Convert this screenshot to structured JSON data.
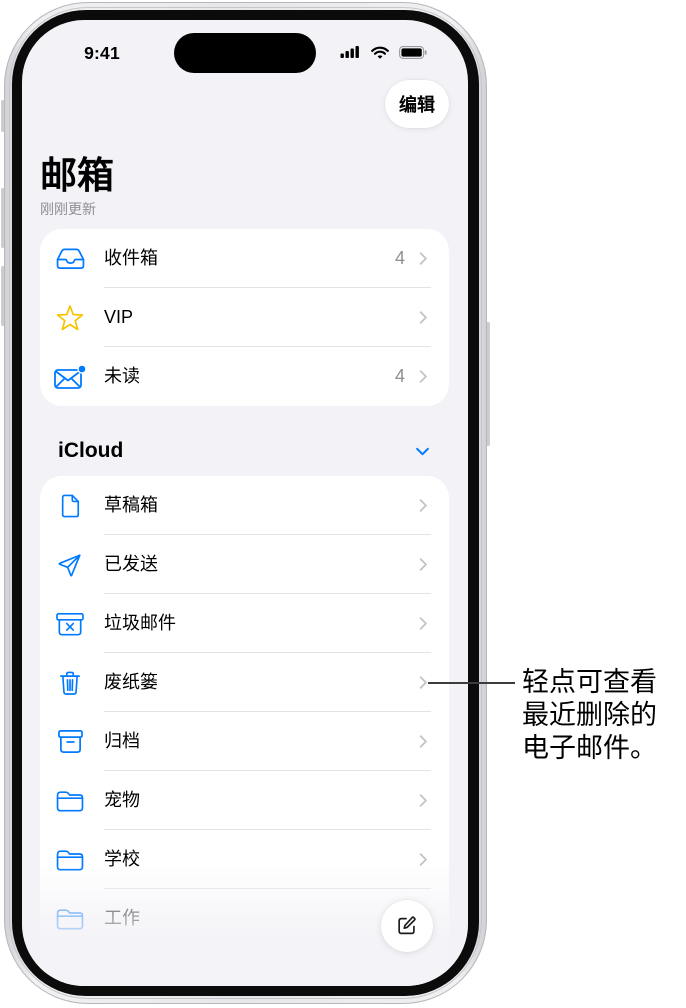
{
  "status_bar": {
    "time": "9:41",
    "icons": [
      "cellular-signal-icon",
      "wifi-icon",
      "battery-icon"
    ]
  },
  "navigation": {
    "edit_label": "编辑",
    "title": "邮箱",
    "subtitle": "刚刚更新"
  },
  "smart_mailboxes": [
    {
      "label": "收件箱",
      "count": "4",
      "icon": "inbox-tray-icon"
    },
    {
      "label": "VIP",
      "icon": "star-icon"
    },
    {
      "label": "未读",
      "count": "4",
      "icon": "unread-envelope-icon"
    }
  ],
  "icloud": {
    "section_title": "iCloud",
    "toggle_icon": "chevron-down-icon",
    "mailboxes": [
      {
        "label": "草稿箱",
        "icon": "draft-document-icon"
      },
      {
        "label": "已发送",
        "icon": "paper-plane-icon"
      },
      {
        "label": "垃圾邮件",
        "icon": "junk-bin-icon"
      },
      {
        "label": "废纸篓",
        "icon": "trash-icon"
      },
      {
        "label": "归档",
        "icon": "archive-box-icon"
      },
      {
        "label": "宠物",
        "icon": "folder-icon"
      },
      {
        "label": "学校",
        "icon": "folder-icon"
      },
      {
        "label": "工作",
        "icon": "folder-icon"
      }
    ]
  },
  "toolbar": {
    "compose_icon": "compose-icon"
  },
  "callout": {
    "lines": [
      "轻点可查看",
      "最近删除的",
      "电子邮件。"
    ]
  },
  "colors": {
    "accent": "#007aff",
    "star": "#f5c400",
    "background": "#f2f2f7",
    "card": "#ffffff",
    "secondary_text": "#8e8e93",
    "chevron": "#c4c4c7"
  }
}
